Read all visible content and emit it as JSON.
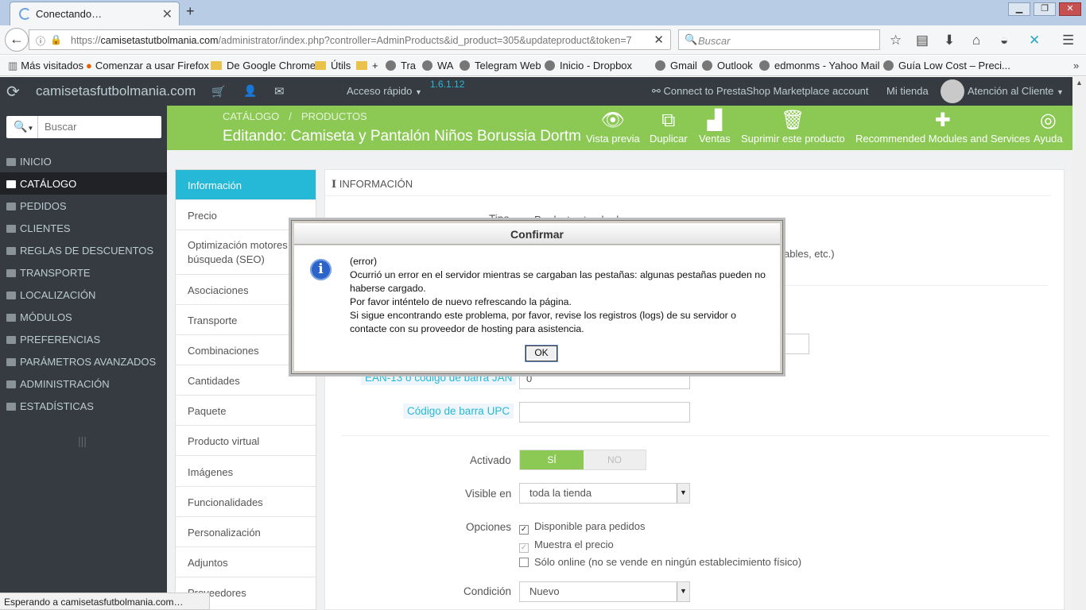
{
  "browser": {
    "tab_title": "Conectando…",
    "new_tab": "+",
    "url_domain": "camisetastutbolmania.com",
    "url_prefix": "https://",
    "url_rest": "/administrator/index.php?controller=AdminProducts&id_product=305&updateproduct&token=7",
    "search_placeholder": "Buscar",
    "bookmarks": [
      "Más visitados",
      "Comenzar a usar Firefox",
      "De Google Chrome",
      "Útils",
      "+",
      "Tra",
      "WA",
      "Telegram Web",
      "Inicio - Dropbox",
      "Gmail",
      "Outlook",
      "edmonms - Yahoo Mail",
      "Guía Low Cost – Preci..."
    ],
    "status_text": "Esperando a camisetasfutbolmania.com…"
  },
  "header": {
    "shop_name": "camisetasfutbolmania.com",
    "quick_access": "Acceso rápido",
    "version": "1.6.1.12",
    "connect": "Connect to PrestaShop Marketplace account",
    "my_shop": "Mi tienda",
    "user": "Atención al Cliente"
  },
  "sidebar": {
    "search_placeholder": "Buscar",
    "items": [
      "INICIO",
      "CATÁLOGO",
      "PEDIDOS",
      "CLIENTES",
      "REGLAS DE DESCUENTOS",
      "TRANSPORTE",
      "LOCALIZACIÓN",
      "MÓDULOS",
      "PREFERENCIAS",
      "PARÁMETROS AVANZADOS",
      "ADMINISTRACIÓN",
      "ESTADÍSTICAS"
    ],
    "active": "CATÁLOGO"
  },
  "toolbar": {
    "breadcrumb": [
      "CATÁLOGO",
      "PRODUCTOS"
    ],
    "title": "Editando: Camiseta y Pantalón Niños Borussia Dortmund",
    "buttons": [
      "Vista previa",
      "Duplicar",
      "Ventas",
      "Suprimir este producto",
      "Recommended Modules and Services",
      "Ayuda"
    ]
  },
  "tabs": [
    "Información",
    "Precio",
    "Optimización motores de búsqueda (SEO)",
    "Asociaciones",
    "Transporte",
    "Combinaciones",
    "Cantidades",
    "Paquete",
    "Producto virtual",
    "Imágenes",
    "Funcionalidades",
    "Personalización",
    "Adjuntos",
    "Proveedores"
  ],
  "panel": {
    "heading": "INFORMACIÓN",
    "type_label": "Tipo",
    "type_value": "Producto standard",
    "type_hidden_tail": "ables, etc.)",
    "ean_label": "EAN-13 o código de barra JAN",
    "ean_value": "0",
    "upc_label": "Código de barra UPC",
    "upc_value": "",
    "active_label": "Activado",
    "active_yes": "SÍ",
    "active_no": "NO",
    "visible_label": "Visible en",
    "visible_value": "toda la tienda",
    "options_label": "Opciones",
    "options": [
      {
        "label": "Disponible para pedidos",
        "checked": true
      },
      {
        "label": "Muestra el precio",
        "checked": true
      },
      {
        "label": "Sólo online (no se vende en ningún establecimiento físico)",
        "checked": false
      }
    ],
    "condition_label": "Condición",
    "condition_value": "Nuevo"
  },
  "dialog": {
    "title": "Confirmar",
    "line1": "(error)",
    "line2": "Ocurrió un error en el servidor mientras se cargaban las pestañas: algunas pestañas pueden no haberse cargado.",
    "line3": "Por favor inténtelo de nuevo refrescando la página.",
    "line4": "Si sigue encontrando este problema, por favor, revise los registros (logs) de su servidor o contacte con su proveedor de hosting para asistencia.",
    "ok": "OK"
  },
  "colors": {
    "accent": "#25b9d7",
    "toolbar": "#8bc954",
    "header": "#363a41"
  }
}
